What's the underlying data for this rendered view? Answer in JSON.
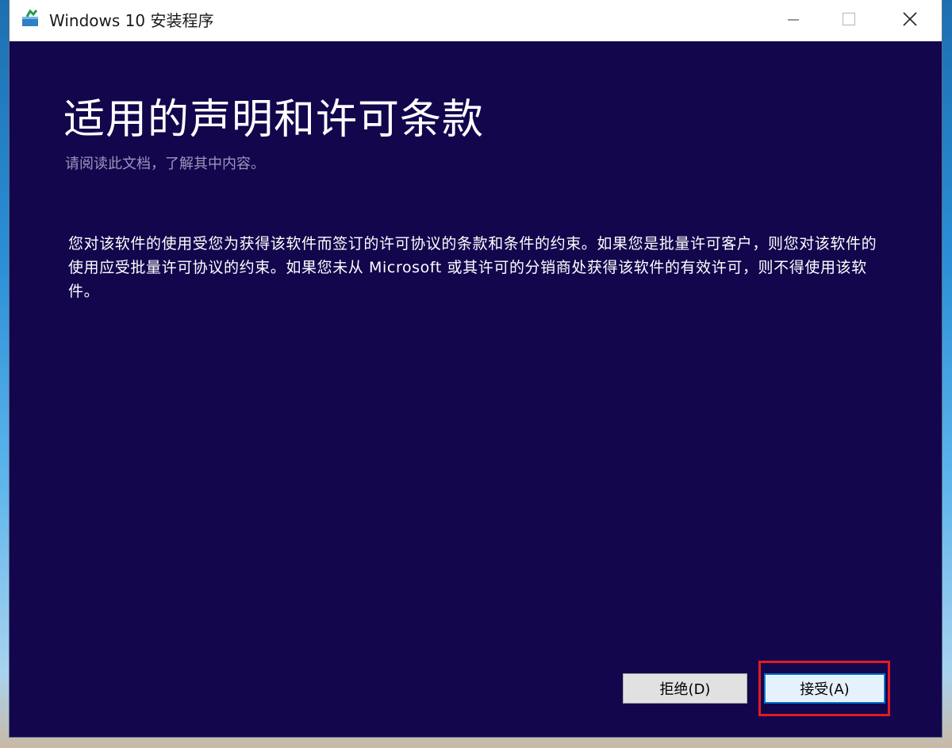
{
  "window": {
    "title": "Windows 10 安装程序",
    "controls": {
      "minimize_icon": "minimize-icon",
      "maximize_icon": "maximize-icon",
      "close_icon": "close-icon"
    }
  },
  "page": {
    "heading": "适用的声明和许可条款",
    "subheading": "请阅读此文档，了解其中内容。",
    "body": "您对该软件的使用受您为获得该软件而签订的许可协议的条款和条件的约束。如果您是批量许可客户，则您对该软件的使用应受批量许可协议的约束。如果您未从 Microsoft 或其许可的分销商处获得该软件的有效许可，则不得使用该软件。"
  },
  "buttons": {
    "decline_label": "拒绝(D)",
    "accept_label": "接受(A)"
  },
  "colors": {
    "window_background": "#13064d",
    "highlight": "#e01b22",
    "accent": "#0078d7"
  }
}
